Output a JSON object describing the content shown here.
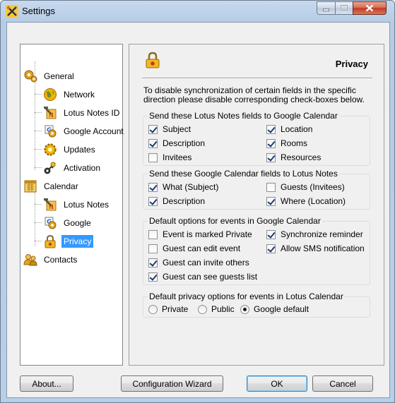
{
  "window": {
    "title": "Settings"
  },
  "tree": {
    "items": [
      {
        "label": "General",
        "icon": "gears-icon"
      },
      {
        "label": "Network",
        "icon": "globe-icon"
      },
      {
        "label": "Lotus Notes ID",
        "icon": "lotus-notes-id-icon"
      },
      {
        "label": "Google Account",
        "icon": "google-account-icon"
      },
      {
        "label": "Updates",
        "icon": "updates-icon"
      },
      {
        "label": "Activation",
        "icon": "activation-key-icon"
      },
      {
        "label": "Calendar",
        "icon": "calendar-icon"
      },
      {
        "label": "Lotus Notes",
        "icon": "lotus-notes-icon"
      },
      {
        "label": "Google",
        "icon": "google-icon"
      },
      {
        "label": "Privacy",
        "icon": "lock-icon",
        "selected": true
      },
      {
        "label": "Contacts",
        "icon": "contacts-icon"
      }
    ]
  },
  "panel": {
    "title": "Privacy",
    "intro": "To disable synchronization of certain fields in the specific direction please disable corresponding check-boxes below.",
    "group1": {
      "legend": "Send these Lotus Notes fields to Google Calendar",
      "items": [
        {
          "label": "Subject",
          "checked": true
        },
        {
          "label": "Location",
          "checked": true
        },
        {
          "label": "Description",
          "checked": true
        },
        {
          "label": "Rooms",
          "checked": true
        },
        {
          "label": "Invitees",
          "checked": false
        },
        {
          "label": "Resources",
          "checked": true
        }
      ]
    },
    "group2": {
      "legend": "Send these Google Calendar fields to Lotus Notes",
      "items": [
        {
          "label": "What (Subject)",
          "checked": true
        },
        {
          "label": "Guests (Invitees)",
          "checked": false
        },
        {
          "label": "Description",
          "checked": true
        },
        {
          "label": "Where (Location)",
          "checked": true
        }
      ]
    },
    "group3": {
      "legend": "Default options for events in Google Calendar",
      "items": [
        {
          "label": "Event is marked Private",
          "checked": false
        },
        {
          "label": "Synchronize reminder",
          "checked": true
        },
        {
          "label": "Guest can edit event",
          "checked": false
        },
        {
          "label": "Allow SMS notification",
          "checked": true
        },
        {
          "label": "Guest can invite others",
          "checked": true
        },
        {
          "label": "Guest can see guests list",
          "checked": true
        }
      ]
    },
    "group4": {
      "legend": "Default privacy options for events in Lotus Calendar",
      "options": [
        {
          "label": "Private",
          "selected": false
        },
        {
          "label": "Public",
          "selected": false
        },
        {
          "label": "Google default",
          "selected": true
        }
      ]
    }
  },
  "buttons": {
    "about": "About...",
    "wizard": "Configuration Wizard",
    "ok": "OK",
    "cancel": "Cancel"
  }
}
